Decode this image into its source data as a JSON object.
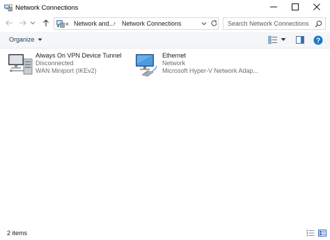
{
  "window": {
    "title": "Network Connections",
    "icons": {
      "app": "network-connections-icon",
      "minimize": "minimize-icon",
      "maximize": "maximize-icon",
      "close": "close-icon"
    }
  },
  "nav": {
    "icons": {
      "back": "back-arrow-icon",
      "forward": "forward-arrow-icon",
      "recent": "chevron-down-icon",
      "up": "up-arrow-icon"
    },
    "address": {
      "overflow": "«",
      "breadcrumbs": [
        "Network and...",
        "Network Connections"
      ],
      "separator": "›"
    },
    "search": {
      "placeholder": "Search Network Connections",
      "value": ""
    }
  },
  "toolbar": {
    "organize_label": "Organize",
    "icons": {
      "view": "change-view-icon",
      "preview_pane": "preview-pane-icon",
      "help": "help-icon"
    }
  },
  "items": [
    {
      "name": "Always On VPN Device Tunnel",
      "status": "Disconnected",
      "device": "WAN Miniport (IKEv2)",
      "icon": "vpn-connection-icon"
    },
    {
      "name": "Ethernet",
      "status": "Network",
      "device": "Microsoft Hyper-V Network Adap...",
      "icon": "ethernet-connection-icon"
    }
  ],
  "status_bar": {
    "item_count": "2 items",
    "icons": {
      "details_view": "details-view-icon",
      "tiles_view": "tiles-view-icon"
    }
  },
  "colors": {
    "accent": "#1e395b",
    "toolbar_bg": "#f5f6f7",
    "help": "#1979ca"
  }
}
